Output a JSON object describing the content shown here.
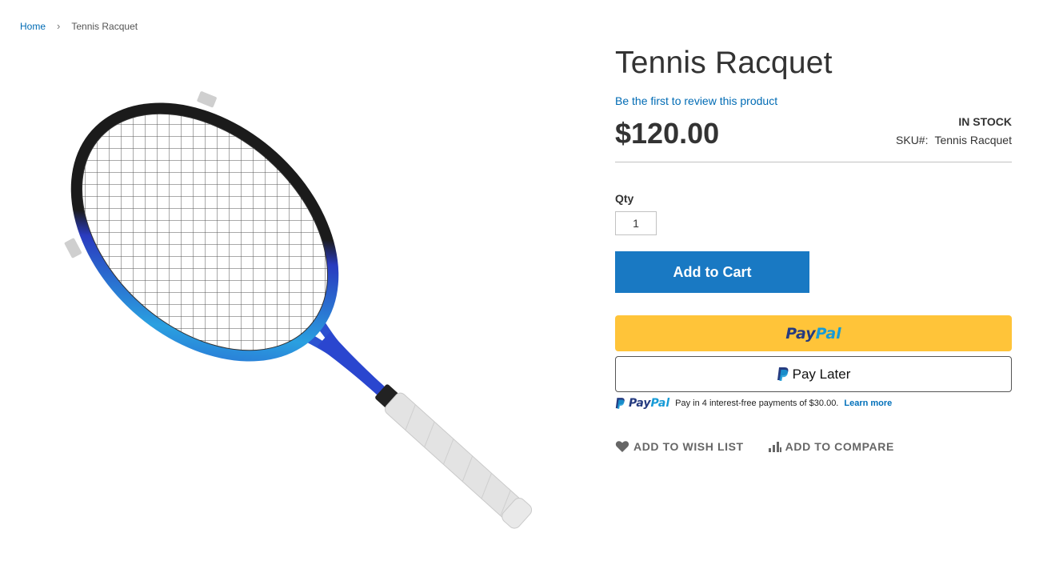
{
  "breadcrumb": {
    "home": "Home",
    "current": "Tennis Racquet"
  },
  "product": {
    "title": "Tennis Racquet",
    "review_link": "Be the first to review this product",
    "price": "$120.00",
    "stock": "IN STOCK",
    "sku_label": "SKU#:",
    "sku_value": "Tennis Racquet"
  },
  "qty": {
    "label": "Qty",
    "value": "1"
  },
  "buttons": {
    "add_to_cart": "Add to Cart",
    "paypal_dark": "Pay",
    "paypal_light": "Pal",
    "pay_later": "Pay Later"
  },
  "paypal_message": {
    "brand_dark": "Pay",
    "brand_light": "Pal",
    "text": "Pay in 4 interest-free payments of $30.00.",
    "learn_more": "Learn more"
  },
  "actions": {
    "wishlist": "ADD TO WISH LIST",
    "compare": "ADD TO COMPARE"
  },
  "colors": {
    "link": "#006bb4",
    "primary": "#1979c3",
    "paypal_yellow": "#ffc439",
    "racquet_blue": "#2a45c8"
  },
  "icons": [
    "chevron-right-icon",
    "heart-icon",
    "compare-icon",
    "paypal-p-icon"
  ]
}
